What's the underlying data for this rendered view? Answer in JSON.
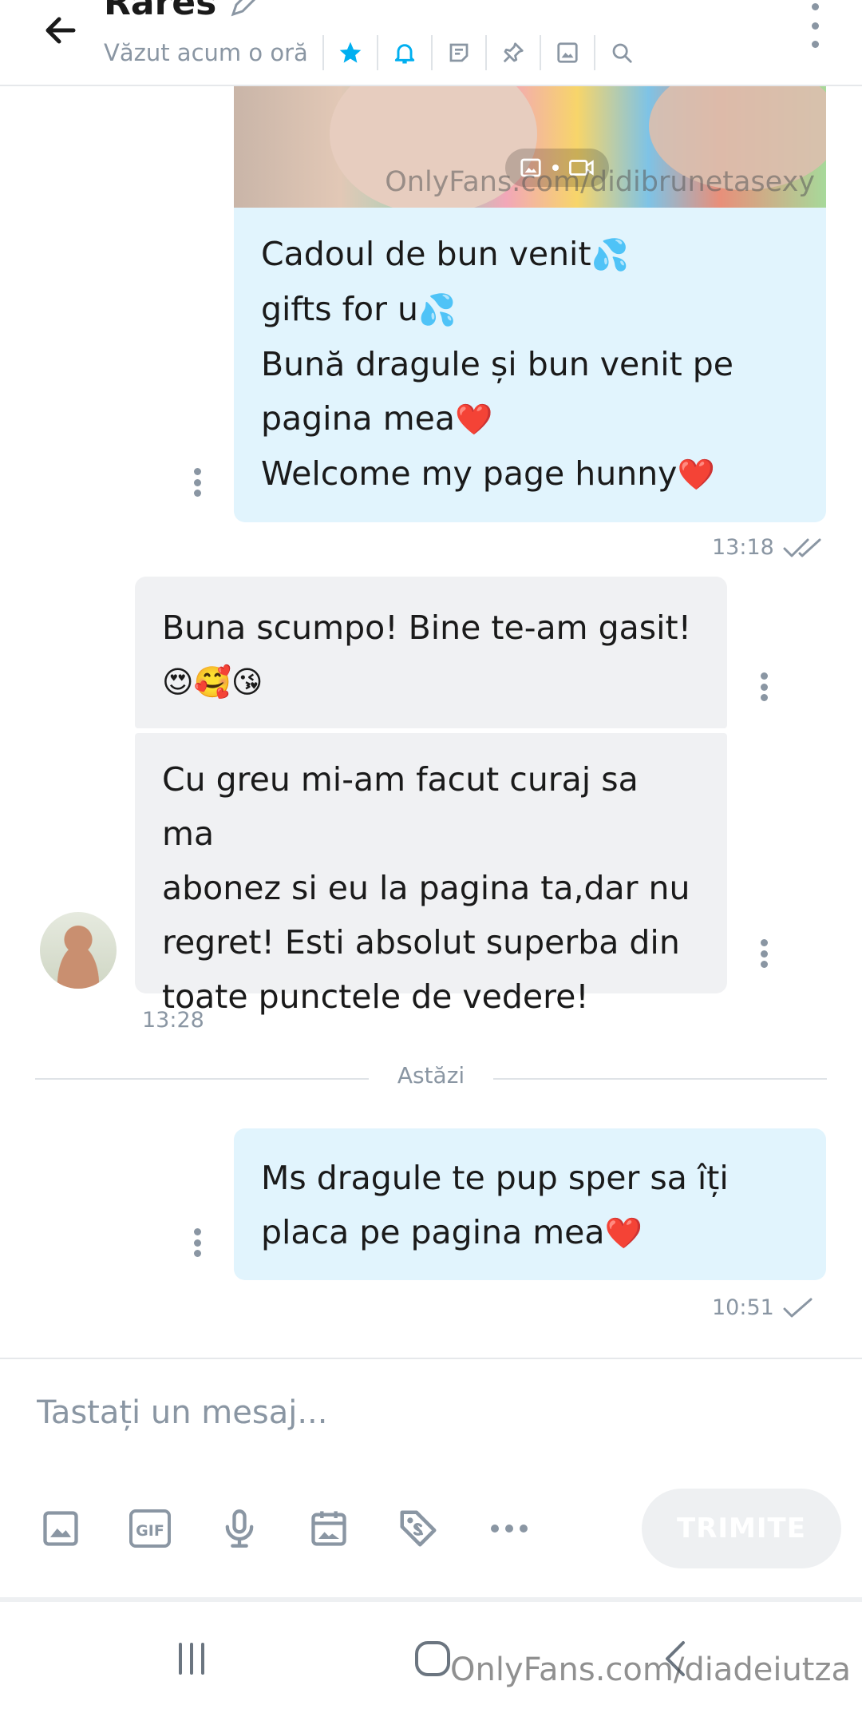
{
  "header": {
    "contact_name": "Rares",
    "last_seen": "Văzut acum o oră"
  },
  "messages": {
    "m1": {
      "media_watermark": "OnlyFans.com/didibrunetasexy",
      "lines": [
        "Cadoul de bun venit",
        "gifts for u",
        "Bună dragule și bun venit pe",
        "pagina mea",
        "Welcome my page hunny"
      ],
      "emojis": [
        "💦",
        "💦",
        "❤️",
        "❤️"
      ],
      "time": "13:18"
    },
    "m2": {
      "lines": [
        "Buna scumpo! Bine te-am gasit!"
      ],
      "emojis": "😍🥰😘"
    },
    "m3": {
      "lines": [
        "Cu greu mi-am facut curaj sa ma",
        "abonez si eu la pagina ta,dar nu",
        "regret! Esti absolut superba din",
        "toate punctele de vedere!"
      ],
      "time": "13:28"
    },
    "day_separator": "Astăzi",
    "m4": {
      "lines": [
        "Ms dragule te pup sper sa îți",
        "placa pe pagina mea"
      ],
      "emojis": [
        "❤️"
      ],
      "time": "10:51"
    }
  },
  "composer": {
    "placeholder": "Tastați un mesaj...",
    "value": "",
    "send_label": "TRIMITE",
    "gif_label": "GIF"
  },
  "watermark_bottom": "OnlyFans.com/diadeiutza",
  "colors": {
    "accent": "#00aff0",
    "outgoing_bubble": "#e1f4fd",
    "incoming_bubble": "#f0f1f3",
    "muted_text": "#8a96a3"
  },
  "icons": [
    "back-arrow-icon",
    "pencil-icon",
    "star-icon",
    "bell-icon",
    "notes-icon",
    "pin-icon",
    "gallery-icon",
    "search-icon",
    "more-vertical-icon",
    "image-icon",
    "gif-icon",
    "microphone-icon",
    "calendar-icon",
    "price-tag-icon",
    "more-horizontal-icon",
    "recents-icon",
    "home-icon",
    "back-nav-icon"
  ]
}
